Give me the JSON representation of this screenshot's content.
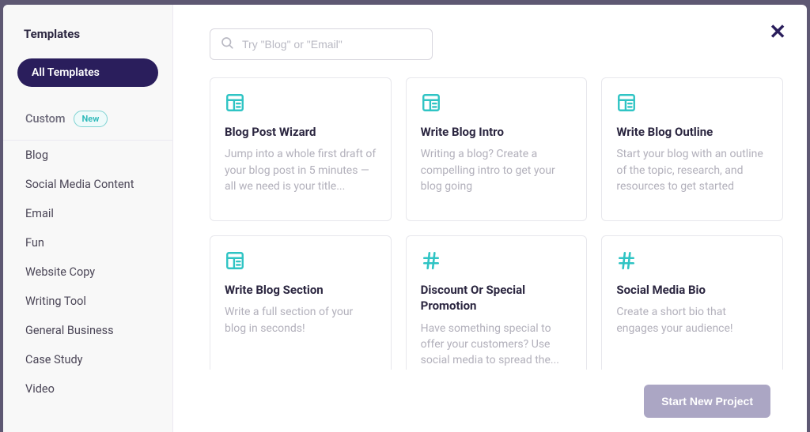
{
  "sidebar": {
    "title": "Templates",
    "all_templates": "All Templates",
    "custom_label": "Custom",
    "new_badge": "New",
    "categories": [
      "Blog",
      "Social Media Content",
      "Email",
      "Fun",
      "Website Copy",
      "Writing Tool",
      "General Business",
      "Case Study",
      "Video"
    ]
  },
  "search": {
    "placeholder": "Try \"Blog\" or \"Email\""
  },
  "cards": [
    {
      "icon": "doc",
      "title": "Blog Post Wizard",
      "desc": "Jump into a whole first draft of your blog post in 5 minutes — all we need is your title..."
    },
    {
      "icon": "doc",
      "title": "Write Blog Intro",
      "desc": "Writing a blog? Create a compelling intro to get your blog going"
    },
    {
      "icon": "doc",
      "title": "Write Blog Outline",
      "desc": "Start your blog with an outline of the topic, research, and resources to get started"
    },
    {
      "icon": "doc",
      "title": "Write Blog Section",
      "desc": "Write a full section of your blog in seconds!"
    },
    {
      "icon": "hash",
      "title": "Discount Or Special Promotion",
      "desc": "Have something special to offer your customers? Use social media to spread the..."
    },
    {
      "icon": "hash",
      "title": "Social Media Bio",
      "desc": "Create a short bio that engages your audience!"
    }
  ],
  "footer": {
    "start_label": "Start New Project"
  }
}
